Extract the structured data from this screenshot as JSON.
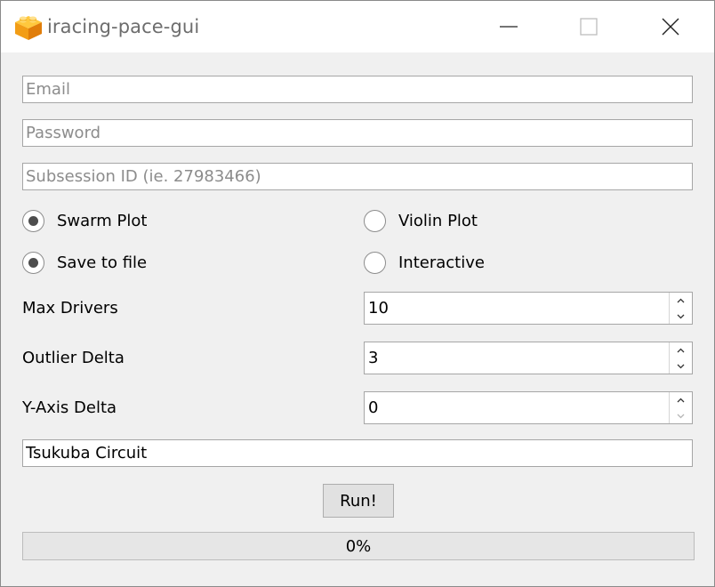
{
  "window": {
    "title": "iracing-pace-gui",
    "icon": "lego-brick-icon",
    "controls": [
      "minimize-icon",
      "maximize-icon",
      "close-icon"
    ]
  },
  "form": {
    "email": {
      "placeholder": "Email",
      "value": ""
    },
    "password": {
      "placeholder": "Password",
      "value": ""
    },
    "subsession": {
      "placeholder": "Subsession ID (ie. 27983466)",
      "value": ""
    },
    "plot_type": {
      "options": [
        {
          "label": "Swarm Plot",
          "selected": true
        },
        {
          "label": "Violin Plot",
          "selected": false
        }
      ]
    },
    "output": {
      "options": [
        {
          "label": "Save to file",
          "selected": true
        },
        {
          "label": "Interactive",
          "selected": false
        }
      ]
    },
    "max_drivers": {
      "label": "Max Drivers",
      "value": "10"
    },
    "outlier_delta": {
      "label": "Outlier Delta",
      "value": "3"
    },
    "y_axis_delta": {
      "label": "Y-Axis Delta",
      "value": "0"
    },
    "track": {
      "value": "Tsukuba Circuit"
    },
    "run_label": "Run!"
  },
  "progress": {
    "value": 0,
    "text": "0%"
  },
  "colors": {
    "icon_orange": "#f5a623",
    "progress_fill": "#06b025"
  }
}
